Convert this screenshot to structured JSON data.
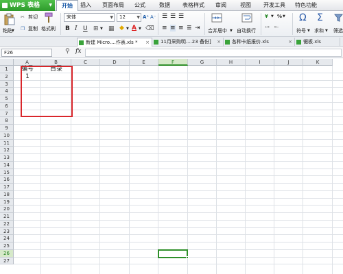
{
  "app": {
    "title": "WPS 表格",
    "brand_color": "#3aa33a",
    "accent_color": "#2f8f2a"
  },
  "menus": [
    "开始",
    "插入",
    "页面布局",
    "公式",
    "数据",
    "表格样式",
    "审阅",
    "视图",
    "开发工具",
    "特色功能"
  ],
  "active_menu": "开始",
  "ribbon": {
    "paste": "粘贴",
    "cut": "剪切",
    "copy": "复制",
    "format_painter": "格式刷",
    "font_name": "宋体",
    "font_size": "12",
    "bold": "B",
    "italic": "I",
    "underline": "U",
    "font_color_glyph": "A",
    "merge_center": "合并居中",
    "wrap_text": "自动换行",
    "symbol": "符号",
    "sum": "求和",
    "filter": "筛选",
    "percent": "%"
  },
  "doc_tabs": [
    {
      "label": "新建 Micro....作表.xls *",
      "active": true
    },
    {
      "label": "11月采购明....23 备份]",
      "active": false
    },
    {
      "label": "各种卡纸报价.xls",
      "active": false
    },
    {
      "label": "锯板.xls",
      "active": false
    }
  ],
  "formula_bar": {
    "name_box": "F26",
    "fx": "fx",
    "formula": ""
  },
  "columns": [
    "A",
    "B",
    "C",
    "D",
    "E",
    "F",
    "G",
    "H",
    "I",
    "J",
    "K"
  ],
  "rows": [
    "1",
    "2",
    "3",
    "4",
    "5",
    "6",
    "7",
    "8",
    "9",
    "10",
    "11",
    "12",
    "13",
    "14",
    "15",
    "16",
    "17",
    "18",
    "19",
    "20",
    "21",
    "22",
    "23",
    "24",
    "25",
    "26",
    "27"
  ],
  "active_cell": {
    "column": "F",
    "row": "26"
  },
  "cells": {
    "A1": "编号",
    "B1": "目录",
    "A2": "1"
  },
  "highlight": {
    "color": "#d9262b",
    "range": "A1:B6"
  }
}
